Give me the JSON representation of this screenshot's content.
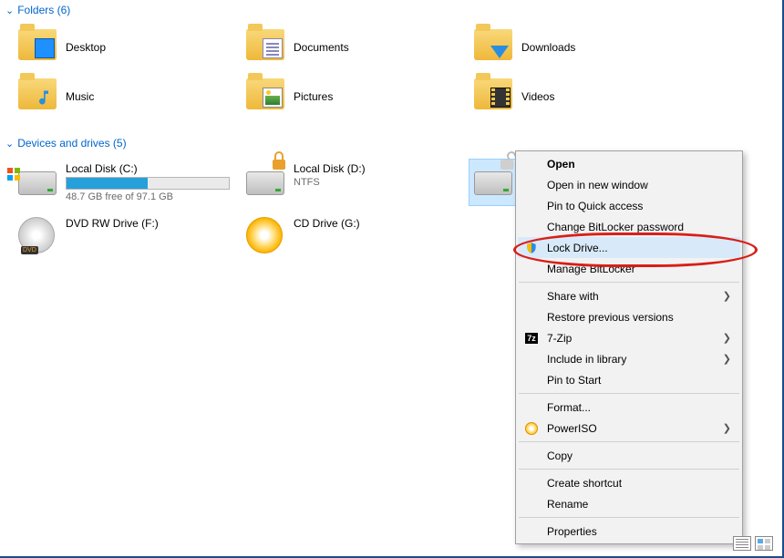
{
  "sections": {
    "folders_header": "Folders (6)",
    "drives_header": "Devices and drives (5)"
  },
  "folders": [
    {
      "label": "Desktop"
    },
    {
      "label": "Documents"
    },
    {
      "label": "Downloads"
    },
    {
      "label": "Music"
    },
    {
      "label": "Pictures"
    },
    {
      "label": "Videos"
    }
  ],
  "drives": {
    "c": {
      "name": "Local Disk (C:)",
      "free": "48.7 GB free of 97.1 GB",
      "fill_pct": 50
    },
    "d": {
      "name": "Local Disk (D:)",
      "sub": "NTFS"
    },
    "dvd": {
      "name": "DVD RW Drive (F:)"
    },
    "cd": {
      "name": "CD Drive (G:)"
    }
  },
  "context_menu": {
    "open": "Open",
    "open_new": "Open in new window",
    "pin_qa": "Pin to Quick access",
    "change_bl": "Change BitLocker password",
    "lock_drive": "Lock Drive...",
    "manage_bl": "Manage BitLocker",
    "share_with": "Share with",
    "restore": "Restore previous versions",
    "sevenzip": "7-Zip",
    "include_lib": "Include in library",
    "pin_start": "Pin to Start",
    "format": "Format...",
    "poweriso": "PowerISO",
    "copy": "Copy",
    "create_shortcut": "Create shortcut",
    "rename": "Rename",
    "properties": "Properties"
  }
}
